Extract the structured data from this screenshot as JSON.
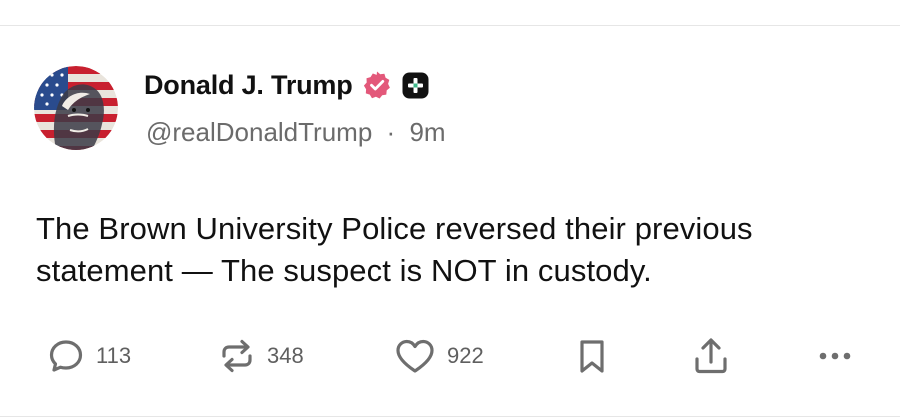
{
  "post": {
    "author": {
      "display_name": "Donald J. Trump",
      "handle": "@realDonaldTrump",
      "separator": "·",
      "time_ago": "9m",
      "verified_icon": "verified-badge-icon",
      "verified_color": "#e3587a",
      "extra_badge_icon": "plus-badge-icon"
    },
    "text": "The Brown University Police reversed their previous statement — The suspect is NOT in custody.",
    "actions": {
      "replies": {
        "icon": "comment-icon",
        "count": "113"
      },
      "reposts": {
        "icon": "repost-icon",
        "count": "348"
      },
      "likes": {
        "icon": "heart-icon",
        "count": "922"
      },
      "bookmark": {
        "icon": "bookmark-icon"
      },
      "share": {
        "icon": "share-icon"
      },
      "more": {
        "icon": "more-icon"
      }
    }
  },
  "colors": {
    "text": "#111111",
    "secondary_text": "#6b6b6b",
    "action_icon": "#6e6e6e",
    "divider": "#e6e6e6"
  }
}
